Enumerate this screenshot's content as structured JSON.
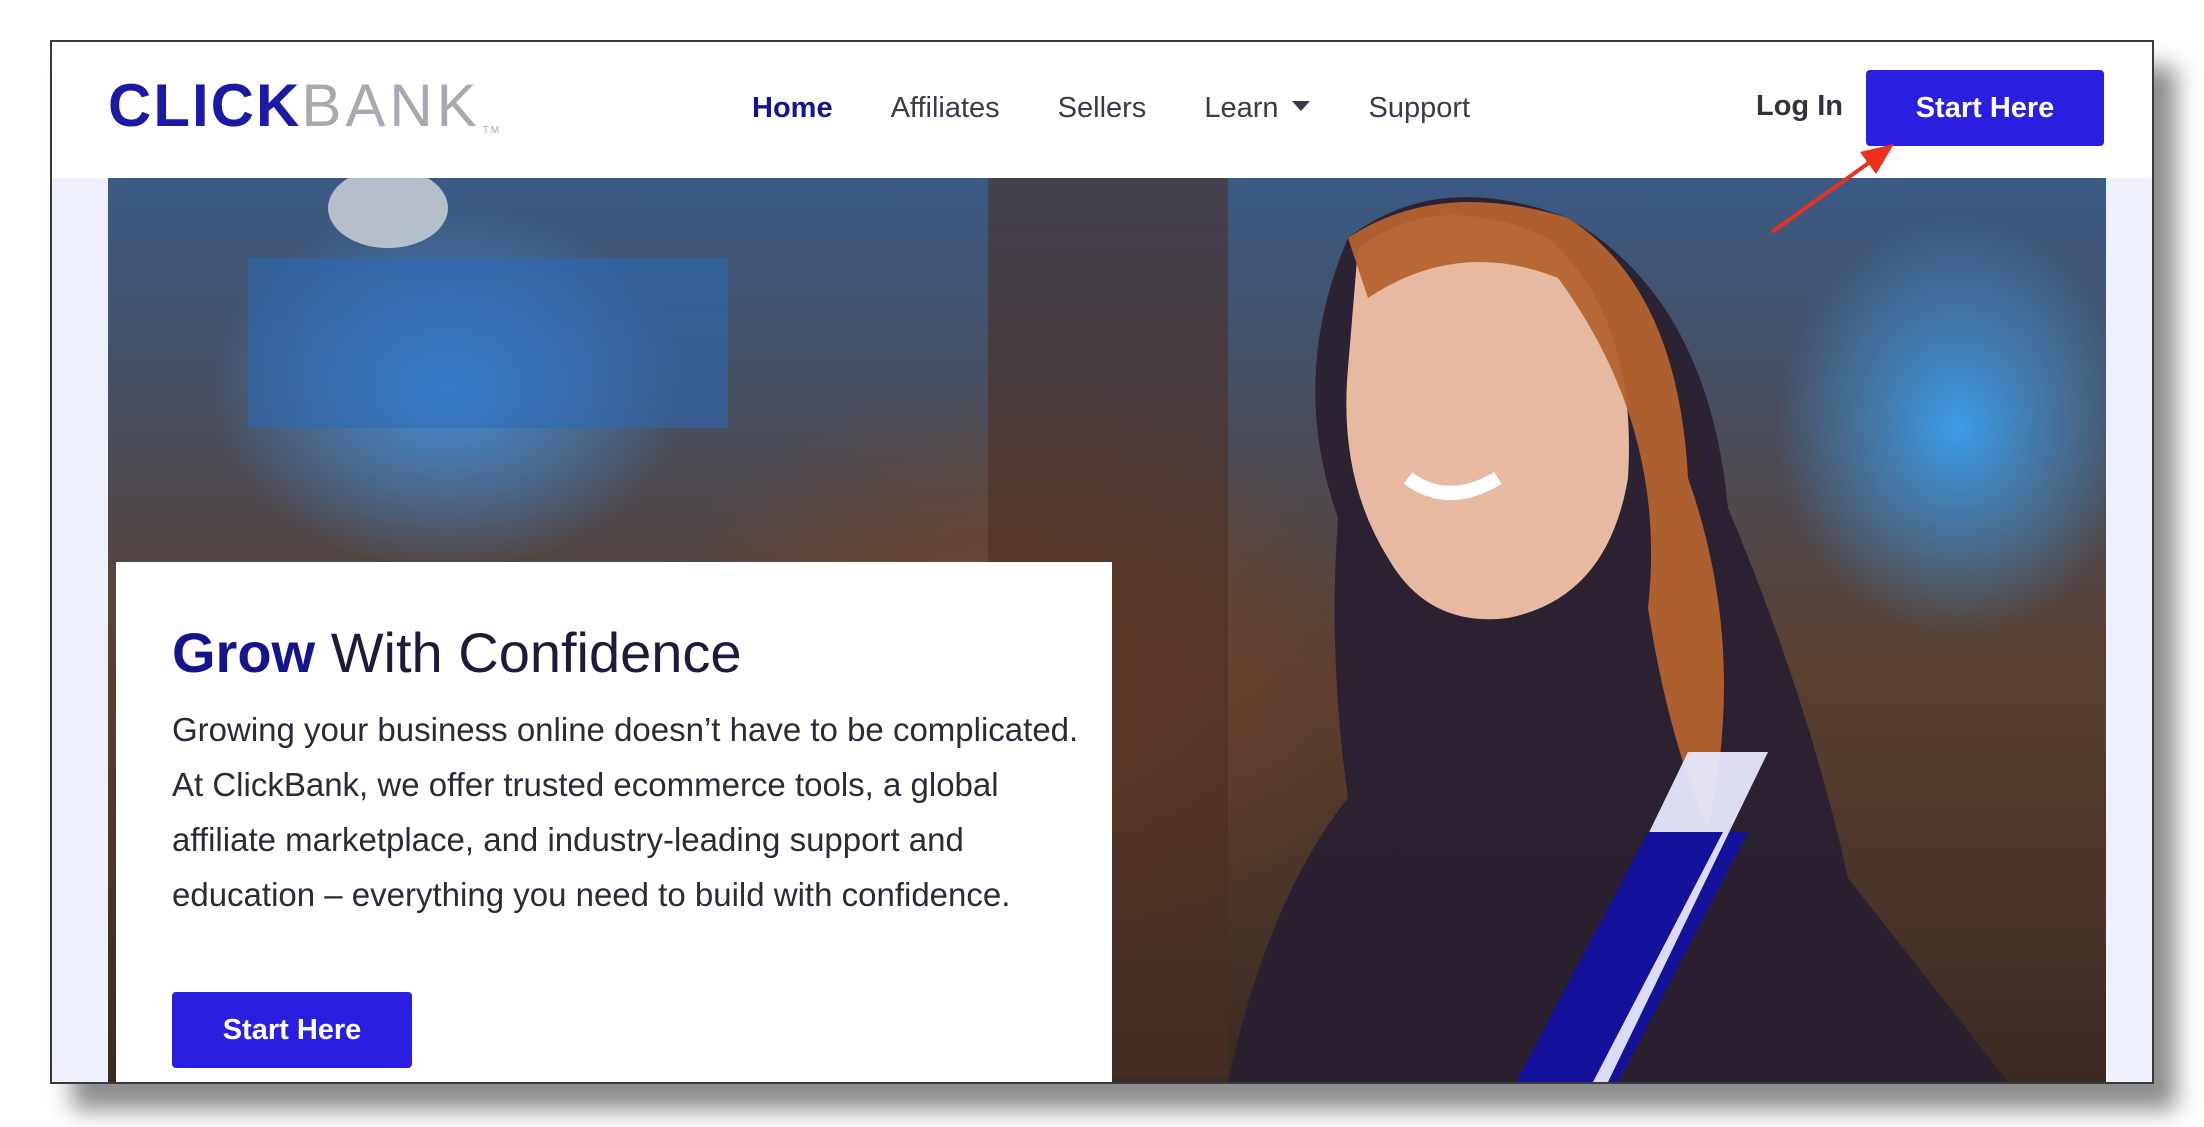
{
  "logo": {
    "part1": "CLICK",
    "part2": "BANK",
    "tm": "TM"
  },
  "nav": {
    "items": [
      {
        "label": "Home",
        "active": true
      },
      {
        "label": "Affiliates",
        "active": false
      },
      {
        "label": "Sellers",
        "active": false
      },
      {
        "label": "Learn",
        "active": false,
        "has_dropdown": true
      },
      {
        "label": "Support",
        "active": false
      }
    ],
    "login_label": "Log In",
    "start_label": "Start Here"
  },
  "hero": {
    "headline_bold": "Grow",
    "headline_rest": "With Confidence",
    "body": "Growing your business online doesn’t have to be complicated. At ClickBank, we offer trusted ecommerce tools, a global affiliate marketplace, and industry-leading support and education – everything you need to build with confidence.",
    "cta_label": "Start Here"
  },
  "colors": {
    "brand": "#15148f",
    "button": "#2a1fe0",
    "annotation_arrow": "#e8321e"
  }
}
